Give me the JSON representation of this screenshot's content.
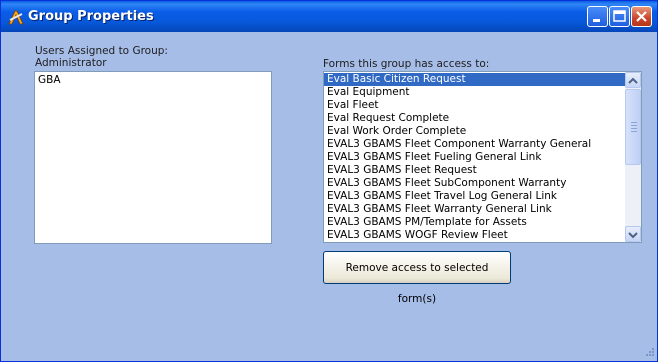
{
  "window": {
    "title": "Group Properties"
  },
  "users": {
    "label_line1": "Users Assigned to Group:",
    "label_line2": "Administrator",
    "items": [
      "GBA"
    ]
  },
  "forms": {
    "label": "Forms this group has access to:",
    "items": [
      "Eval Basic Citizen Request",
      "Eval Equipment",
      "Eval Fleet",
      "Eval Request Complete",
      "Eval Work Order Complete",
      "EVAL3 GBAMS Fleet Component Warranty General",
      "EVAL3 GBAMS Fleet Fueling General Link",
      "EVAL3 GBAMS Fleet Request",
      "EVAL3 GBAMS Fleet SubComponent Warranty",
      "EVAL3 GBAMS Fleet Travel Log General Link",
      "EVAL3 GBAMS Fleet Warranty General Link",
      "EVAL3 GBAMS PM/Template for Assets",
      "EVAL3 GBAMS WOGF Review Fleet"
    ],
    "selected_index": 0
  },
  "actions": {
    "remove_access_label": "Remove access to selected form(s)"
  },
  "colors": {
    "background": "#a6bde8",
    "titlebar": "#0a5de8",
    "selection": "#316ac5"
  }
}
